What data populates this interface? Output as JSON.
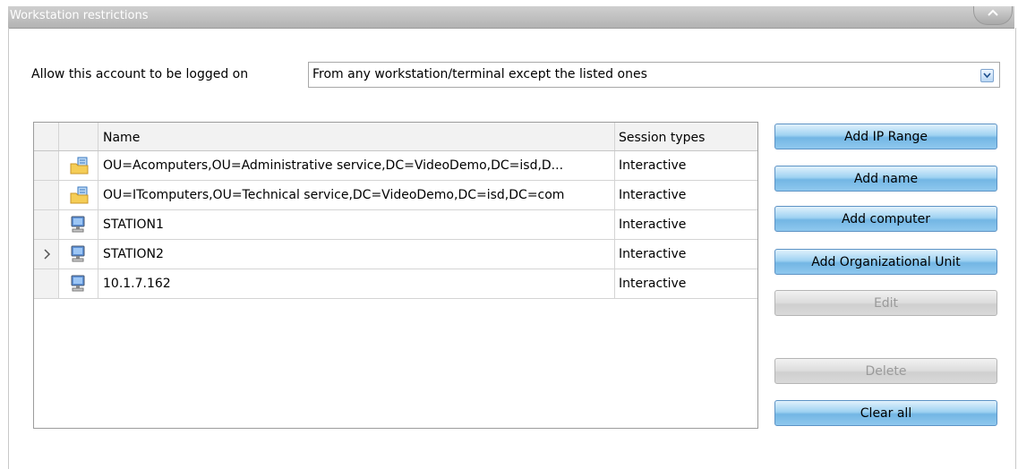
{
  "panel": {
    "title": "Workstation restrictions"
  },
  "allow": {
    "label": "Allow this account to be logged on",
    "selected": "From any workstation/terminal except the listed ones"
  },
  "grid": {
    "columns": {
      "name": "Name",
      "session": "Session types"
    },
    "rows": [
      {
        "icon": "ou-folder-icon",
        "name": "OU=Acomputers,OU=Administrative service,DC=VideoDemo,DC=isd,D...",
        "session": "Interactive",
        "current": false
      },
      {
        "icon": "ou-folder-icon",
        "name": "OU=ITcomputers,OU=Technical service,DC=VideoDemo,DC=isd,DC=com",
        "session": "Interactive",
        "current": false
      },
      {
        "icon": "computer-icon",
        "name": "STATION1",
        "session": "Interactive",
        "current": false
      },
      {
        "icon": "computer-icon",
        "name": "STATION2",
        "session": "Interactive",
        "current": true
      },
      {
        "icon": "computer-icon",
        "name": "10.1.7.162",
        "session": "Interactive",
        "current": false
      }
    ]
  },
  "buttons": {
    "add_ip_range": "Add IP Range",
    "add_name": "Add name",
    "add_computer": "Add computer",
    "add_ou": "Add Organizational Unit",
    "edit": "Edit",
    "delete": "Delete",
    "clear_all": "Clear all"
  },
  "colors": {
    "accent": "#8fc8ee",
    "header": "#b8b8b8"
  }
}
